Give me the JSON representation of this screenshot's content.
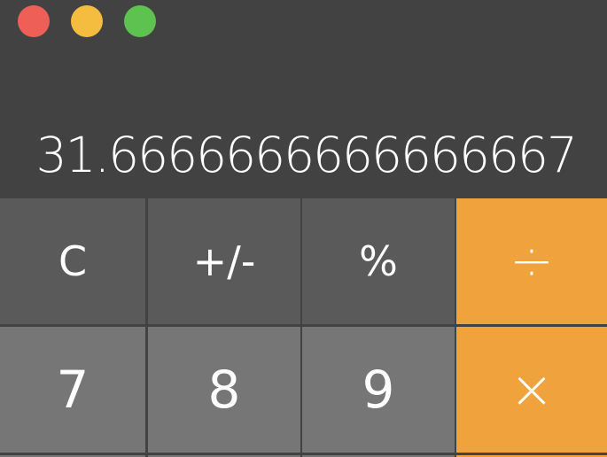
{
  "window": {
    "traffic_lights": {
      "close_color": "#ee5f57",
      "minimize_color": "#f4bd3f",
      "zoom_color": "#5dc24f"
    }
  },
  "display": {
    "value": "31.6666666666666667"
  },
  "keys": {
    "row1": [
      "C",
      "+/-",
      "%",
      "÷"
    ],
    "row2": [
      "7",
      "8",
      "9",
      "×"
    ]
  },
  "colors": {
    "background": "#424242",
    "function_key": "#5a5a5a",
    "number_key": "#767676",
    "operator_key": "#f0a33d"
  }
}
